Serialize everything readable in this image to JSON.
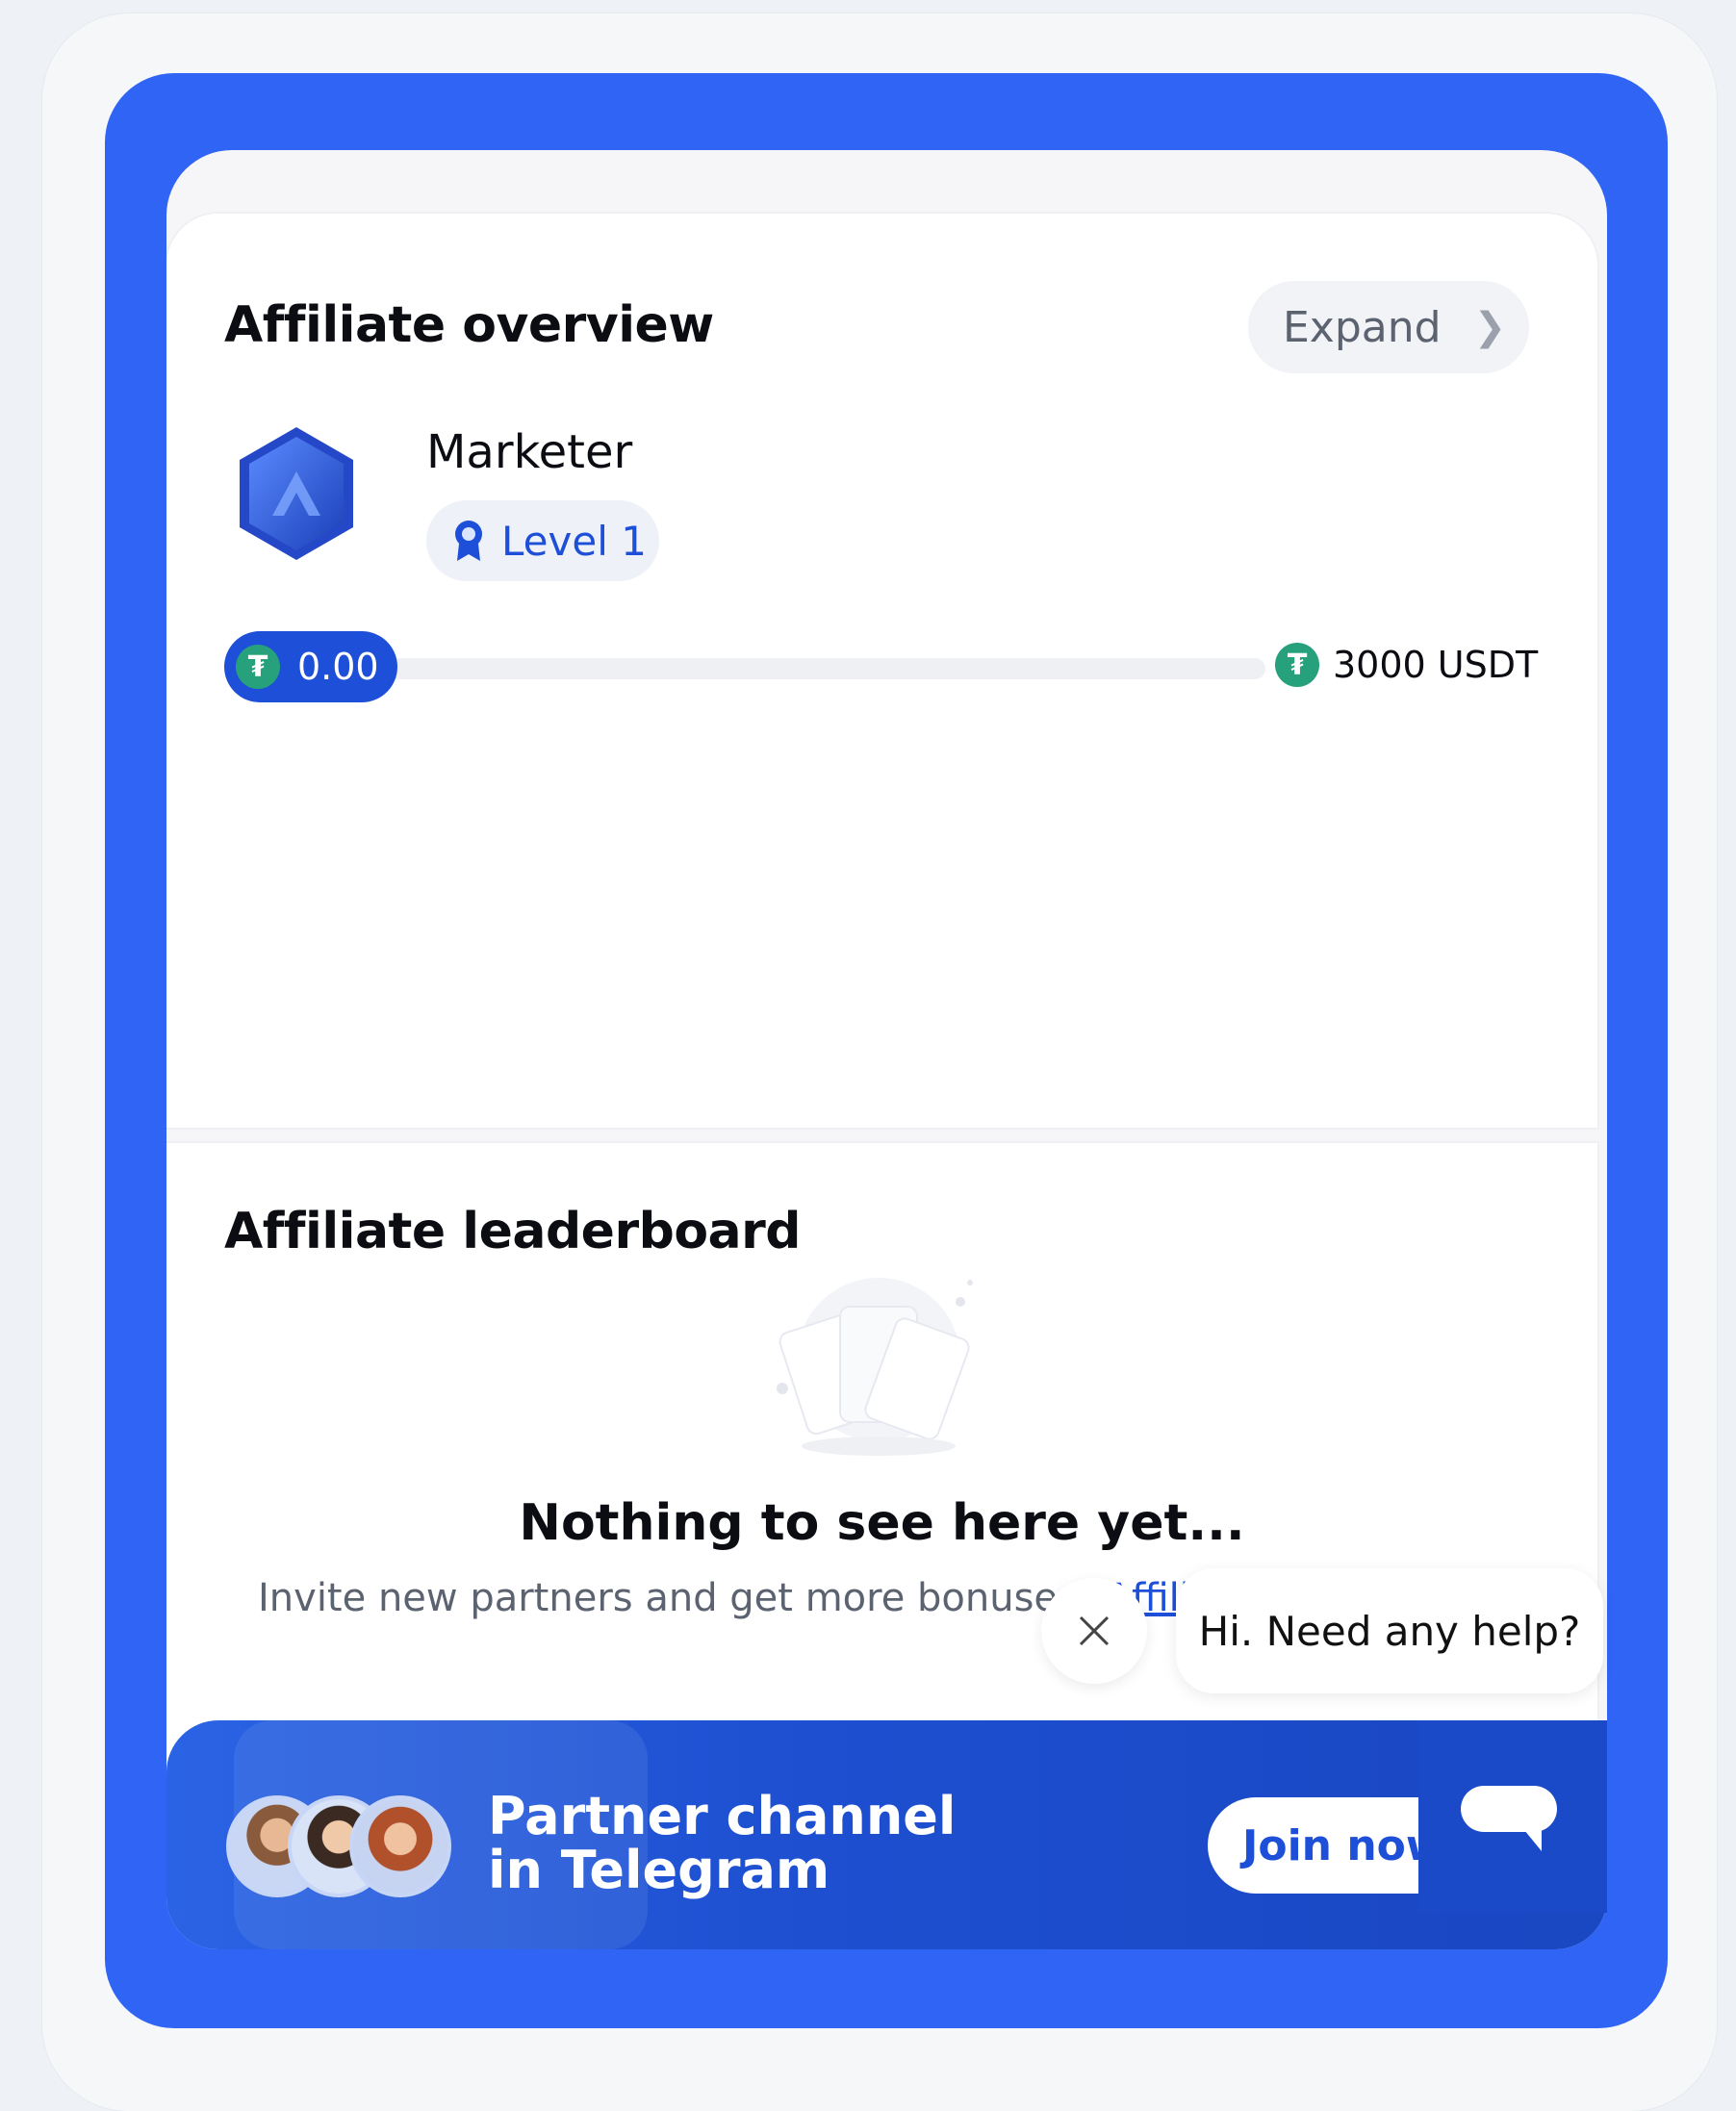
{
  "overview": {
    "title": "Affiliate overview",
    "expand_label": "Expand",
    "role": "Marketer",
    "level_label": "Level 1",
    "progress": {
      "current": "0.00",
      "target": "3000 USDT",
      "coin_symbol": "₮",
      "fraction": 0
    }
  },
  "leaderboard": {
    "title": "Affiliate leaderboard",
    "empty_title": "Nothing to see here yet...",
    "empty_text": "Invite new partners and get more bonuses!",
    "empty_link": "Affili"
  },
  "banner": {
    "title": "Partner channel in Telegram",
    "join_label": "Join now"
  },
  "help": {
    "message": "Hi. Need any help?"
  },
  "colors": {
    "brand_blue": "#2f64f5",
    "accent": "#1d4fd8",
    "tether_green": "#26a17b"
  },
  "icons": [
    "chevron-right-icon",
    "hexagon-badge-icon",
    "award-ribbon-icon",
    "tether-coin-icon",
    "close-icon",
    "chat-bubble-icon"
  ]
}
